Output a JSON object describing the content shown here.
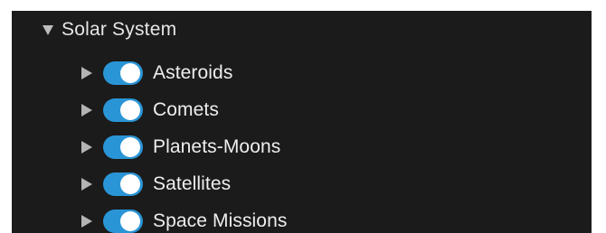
{
  "tree": {
    "root": {
      "label": "Solar System",
      "expanded": true,
      "caret_icon": "caret-down-icon"
    },
    "items": [
      {
        "label": "Asteroids",
        "enabled": true,
        "expanded": false,
        "caret_icon": "caret-right-icon"
      },
      {
        "label": "Comets",
        "enabled": true,
        "expanded": false,
        "caret_icon": "caret-right-icon"
      },
      {
        "label": "Planets-Moons",
        "enabled": true,
        "expanded": false,
        "caret_icon": "caret-right-icon"
      },
      {
        "label": "Satellites",
        "enabled": true,
        "expanded": false,
        "caret_icon": "caret-right-icon"
      },
      {
        "label": "Space Missions",
        "enabled": true,
        "expanded": false,
        "caret_icon": "caret-right-icon"
      }
    ]
  },
  "colors": {
    "panel_background": "#1b1b1b",
    "toggle_on": "#2a95d6",
    "toggle_knob": "#ffffff",
    "text": "#eeeeee",
    "caret": "#b4b4b4"
  }
}
